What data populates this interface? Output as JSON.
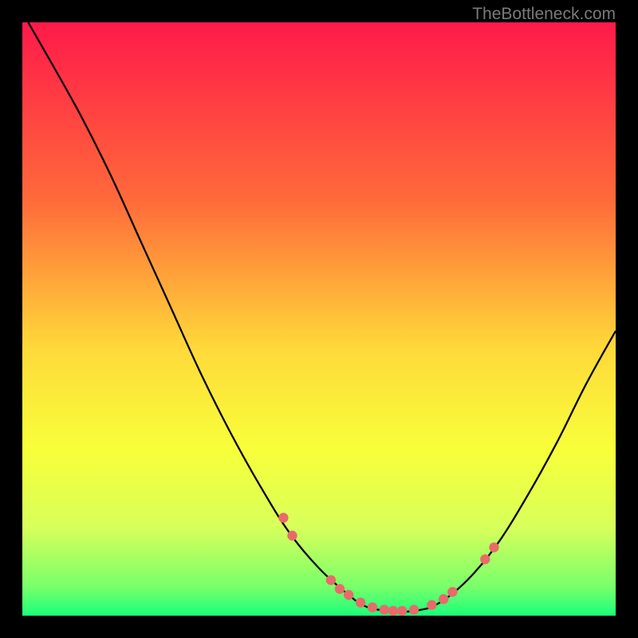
{
  "watermark": "TheBottleneck.com",
  "chart_data": {
    "type": "line",
    "title": "",
    "xlabel": "",
    "ylabel": "",
    "xlim": [
      0,
      100
    ],
    "ylim": [
      0,
      100
    ],
    "background_gradient": {
      "stops": [
        {
          "offset": 0,
          "color": "#ff1a4a"
        },
        {
          "offset": 30,
          "color": "#ff6a3a"
        },
        {
          "offset": 55,
          "color": "#ffd93a"
        },
        {
          "offset": 72,
          "color": "#f8ff3a"
        },
        {
          "offset": 85,
          "color": "#d8ff5a"
        },
        {
          "offset": 95,
          "color": "#7aff6a"
        },
        {
          "offset": 100,
          "color": "#1aff7a"
        }
      ]
    },
    "curve": {
      "description": "Bottleneck percentage curve (V-shape)",
      "points": [
        {
          "x": 1,
          "y": 100
        },
        {
          "x": 5,
          "y": 93
        },
        {
          "x": 10,
          "y": 84
        },
        {
          "x": 15,
          "y": 74
        },
        {
          "x": 20,
          "y": 63
        },
        {
          "x": 25,
          "y": 52
        },
        {
          "x": 30,
          "y": 41
        },
        {
          "x": 35,
          "y": 31
        },
        {
          "x": 40,
          "y": 22
        },
        {
          "x": 45,
          "y": 14
        },
        {
          "x": 50,
          "y": 8
        },
        {
          "x": 55,
          "y": 3.5
        },
        {
          "x": 58,
          "y": 1.5
        },
        {
          "x": 62,
          "y": 0.8
        },
        {
          "x": 66,
          "y": 0.8
        },
        {
          "x": 70,
          "y": 2
        },
        {
          "x": 75,
          "y": 6
        },
        {
          "x": 80,
          "y": 12
        },
        {
          "x": 85,
          "y": 20
        },
        {
          "x": 90,
          "y": 29
        },
        {
          "x": 95,
          "y": 39
        },
        {
          "x": 100,
          "y": 48
        }
      ]
    },
    "markers": {
      "color": "#e86a6a",
      "radius": 6.2,
      "points": [
        {
          "x": 44,
          "y": 16.5
        },
        {
          "x": 45.5,
          "y": 13.5
        },
        {
          "x": 52,
          "y": 6
        },
        {
          "x": 53.5,
          "y": 4.5
        },
        {
          "x": 55,
          "y": 3.5
        },
        {
          "x": 57,
          "y": 2.2
        },
        {
          "x": 59,
          "y": 1.4
        },
        {
          "x": 61,
          "y": 1
        },
        {
          "x": 62.5,
          "y": 0.8
        },
        {
          "x": 64,
          "y": 0.8
        },
        {
          "x": 66,
          "y": 1
        },
        {
          "x": 69,
          "y": 1.8
        },
        {
          "x": 71,
          "y": 2.8
        },
        {
          "x": 72.5,
          "y": 4
        },
        {
          "x": 78,
          "y": 9.5
        },
        {
          "x": 79.5,
          "y": 11.5
        }
      ]
    }
  }
}
